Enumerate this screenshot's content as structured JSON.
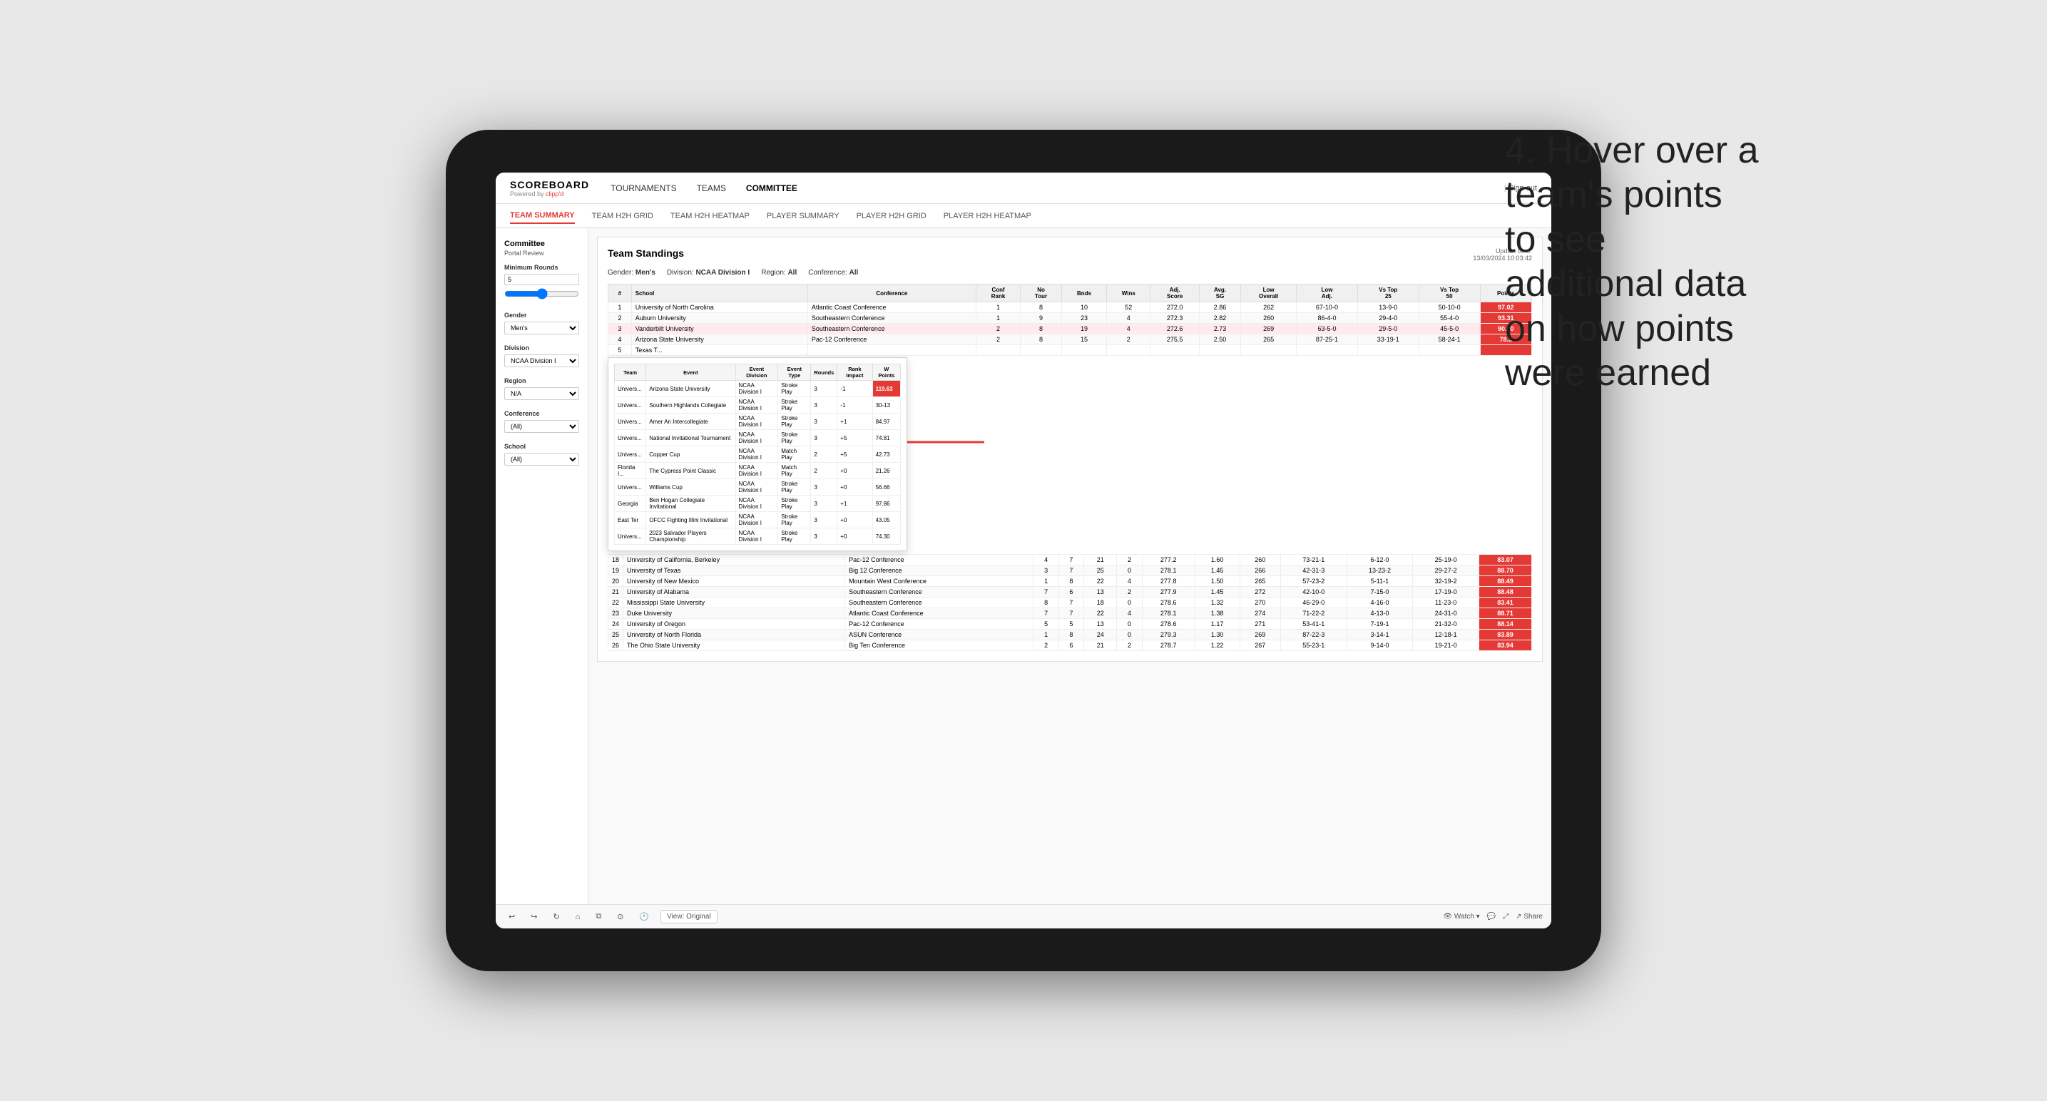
{
  "tablet": {
    "nav": {
      "logo_main": "SCOREBOARD",
      "logo_sub_prefix": "Powered by ",
      "logo_sub_brand": "clipp'd",
      "links": [
        {
          "label": "TOURNAMENTS",
          "active": false
        },
        {
          "label": "TEAMS",
          "active": false
        },
        {
          "label": "COMMITTEE",
          "active": true
        }
      ],
      "sign_out": "Sign out"
    },
    "sub_nav": [
      {
        "label": "TEAM SUMMARY",
        "active": true
      },
      {
        "label": "TEAM H2H GRID",
        "active": false
      },
      {
        "label": "TEAM H2H HEATMAP",
        "active": false
      },
      {
        "label": "PLAYER SUMMARY",
        "active": false
      },
      {
        "label": "PLAYER H2H GRID",
        "active": false
      },
      {
        "label": "PLAYER H2H HEATMAP",
        "active": false
      }
    ],
    "sidebar": {
      "heading": "Committee",
      "subheading": "Portal Review",
      "min_rounds_label": "Minimum Rounds",
      "gender_label": "Gender",
      "gender_value": "Men's",
      "division_label": "Division",
      "division_value": "NCAA Division I",
      "region_label": "Region",
      "region_value": "N/A",
      "conference_label": "Conference",
      "conference_value": "(All)",
      "school_label": "School",
      "school_value": "(All)"
    },
    "report": {
      "title": "Team Standings",
      "update_time": "Update time:",
      "update_date": "13/03/2024 10:03:42",
      "gender_label": "Gender:",
      "gender_value": "Men's",
      "division_label": "Division:",
      "division_value": "NCAA Division I",
      "region_label": "Region:",
      "region_value": "All",
      "conference_label": "Conference:",
      "conference_value": "All",
      "columns": [
        "#",
        "School",
        "Conference",
        "Conf Rank",
        "No Tour",
        "Bnds",
        "Wins",
        "Adj. Score",
        "Avg. SG",
        "Low Overall",
        "Low Adj.",
        "Vs Top 25",
        "Vs Top 50",
        "Points"
      ],
      "rows": [
        {
          "rank": 1,
          "school": "University of North Carolina",
          "conference": "Atlantic Coast Conference",
          "conf_rank": 1,
          "no_tour": 8,
          "bnds": 10,
          "wins": 52,
          "adj_score": "272.0",
          "avg_sg": "2.86",
          "low": "262",
          "low_adj": "67-10-0",
          "vs25": "13-9-0",
          "vs50": "50-10-0",
          "points": "97.02",
          "highlight": false
        },
        {
          "rank": 2,
          "school": "Auburn University",
          "conference": "Southeastern Conference",
          "conf_rank": 1,
          "no_tour": 9,
          "bnds": 23,
          "wins": 4,
          "adj_score": "272.3",
          "avg_sg": "2.82",
          "low": "260",
          "low_adj": "86-4-0",
          "vs25": "29-4-0",
          "vs50": "55-4-0",
          "points": "93.31",
          "highlight": false
        },
        {
          "rank": 3,
          "school": "Vanderbilt University",
          "conference": "Southeastern Conference",
          "conf_rank": 2,
          "no_tour": 8,
          "bnds": 19,
          "wins": 4,
          "adj_score": "272.6",
          "avg_sg": "2.73",
          "low": "269",
          "low_adj": "63-5-0",
          "vs25": "29-5-0",
          "vs50": "45-5-0",
          "points": "90.30",
          "highlight": true
        },
        {
          "rank": 4,
          "school": "Arizona State University",
          "conference": "Pac-12 Conference",
          "conf_rank": 2,
          "no_tour": 8,
          "bnds": 15,
          "wins": 2,
          "adj_score": "275.5",
          "avg_sg": "2.50",
          "low": "265",
          "low_adj": "87-25-1",
          "vs25": "33-19-1",
          "vs50": "58-24-1",
          "points": "78.5",
          "highlight": false
        },
        {
          "rank": 5,
          "school": "Texas T...",
          "conference": "",
          "conf_rank": "",
          "no_tour": "",
          "bnds": "",
          "wins": "",
          "adj_score": "",
          "avg_sg": "",
          "low": "",
          "low_adj": "",
          "vs25": "",
          "vs50": "",
          "points": "",
          "highlight": false
        }
      ],
      "tooltip_visible": true,
      "tooltip_school": "Vanderbilt University",
      "tooltip_columns": [
        "Team",
        "Event",
        "Event Division",
        "Event Type",
        "Rounds",
        "Rank Impact",
        "W Points"
      ],
      "tooltip_rows": [
        {
          "team": "Univers...",
          "event": "Arizona State University",
          "event_div": "NCAA Division I",
          "event_type": "Stroke Play",
          "rounds": 3,
          "rank_impact": -1,
          "w_points": "119.63"
        },
        {
          "team": "Univers...",
          "event": "Southern Highlands Collegiate",
          "event_div": "NCAA Division I",
          "event_type": "Stroke Play",
          "rounds": 3,
          "rank_impact": -1,
          "w_points": "30-13"
        },
        {
          "team": "Univers...",
          "event": "Amer An Intercollegiate",
          "event_div": "NCAA Division I",
          "event_type": "Stroke Play",
          "rounds": 3,
          "rank_impact": "+1",
          "w_points": "84.97"
        },
        {
          "team": "Univers...",
          "event": "National Invitational Tournament",
          "event_div": "NCAA Division I",
          "event_type": "Stroke Play",
          "rounds": 3,
          "rank_impact": "+5",
          "w_points": "74.81"
        },
        {
          "team": "Univers...",
          "event": "Copper Cup",
          "event_div": "NCAA Division I",
          "event_type": "Match Play",
          "rounds": 2,
          "rank_impact": "+5",
          "w_points": "42.73"
        },
        {
          "team": "Florida I...",
          "event": "The Cypress Point Classic",
          "event_div": "NCAA Division I",
          "event_type": "Match Play",
          "rounds": 2,
          "rank_impact": "+0",
          "w_points": "21.26"
        },
        {
          "team": "Univers...",
          "event": "Williams Cup",
          "event_div": "NCAA Division I",
          "event_type": "Stroke Play",
          "rounds": 3,
          "rank_impact": "+0",
          "w_points": "56.66"
        },
        {
          "team": "Georgia",
          "event": "Ben Hogan Collegiate Invitational",
          "event_div": "NCAA Division I",
          "event_type": "Stroke Play",
          "rounds": 3,
          "rank_impact": "+1",
          "w_points": "97.86"
        },
        {
          "team": "East Ter",
          "event": "OFCC Fighting Illini Invitational",
          "event_div": "NCAA Division I",
          "event_type": "Stroke Play",
          "rounds": 3,
          "rank_impact": "+0",
          "w_points": "43.05"
        },
        {
          "team": "Univers...",
          "event": "2023 Salvador Players Championship",
          "event_div": "NCAA Division I",
          "event_type": "Stroke Play",
          "rounds": 3,
          "rank_impact": "+0",
          "w_points": "74.30"
        }
      ],
      "more_rows": [
        {
          "rank": 18,
          "school": "University of California, Berkeley",
          "conference": "Pac-12 Conference",
          "conf_rank": 4,
          "no_tour": 7,
          "bnds": 21,
          "wins": 2,
          "adj_score": "277.2",
          "avg_sg": "1.60",
          "low": "260",
          "low_adj": "73-21-1",
          "vs25": "6-12-0",
          "vs50": "25-19-0",
          "points": "83.07"
        },
        {
          "rank": 19,
          "school": "University of Texas",
          "conference": "Big 12 Conference",
          "conf_rank": 3,
          "no_tour": 7,
          "bnds": 25,
          "wins": 0,
          "adj_score": "278.1",
          "avg_sg": "1.45",
          "low": "266",
          "low_adj": "42-31-3",
          "vs25": "13-23-2",
          "vs50": "29-27-2",
          "points": "88.70"
        },
        {
          "rank": 20,
          "school": "University of New Mexico",
          "conference": "Mountain West Conference",
          "conf_rank": 1,
          "no_tour": 8,
          "bnds": 22,
          "wins": 4,
          "adj_score": "277.8",
          "avg_sg": "1.50",
          "low": "265",
          "low_adj": "57-23-2",
          "vs25": "5-11-1",
          "vs50": "32-19-2",
          "points": "88.49"
        },
        {
          "rank": 21,
          "school": "University of Alabama",
          "conference": "Southeastern Conference",
          "conf_rank": 7,
          "no_tour": 6,
          "bnds": 13,
          "wins": 2,
          "adj_score": "277.9",
          "avg_sg": "1.45",
          "low": "272",
          "low_adj": "42-10-0",
          "vs25": "7-15-0",
          "vs50": "17-19-0",
          "points": "88.48"
        },
        {
          "rank": 22,
          "school": "Mississippi State University",
          "conference": "Southeastern Conference",
          "conf_rank": 8,
          "no_tour": 7,
          "bnds": 18,
          "wins": 0,
          "adj_score": "278.6",
          "avg_sg": "1.32",
          "low": "270",
          "low_adj": "46-29-0",
          "vs25": "4-16-0",
          "vs50": "11-23-0",
          "points": "83.41"
        },
        {
          "rank": 23,
          "school": "Duke University",
          "conference": "Atlantic Coast Conference",
          "conf_rank": 7,
          "no_tour": 7,
          "bnds": 22,
          "wins": 4,
          "adj_score": "278.1",
          "avg_sg": "1.38",
          "low": "274",
          "low_adj": "71-22-2",
          "vs25": "4-13-0",
          "vs50": "24-31-0",
          "points": "88.71"
        },
        {
          "rank": 24,
          "school": "University of Oregon",
          "conference": "Pac-12 Conference",
          "conf_rank": 5,
          "no_tour": 5,
          "bnds": 13,
          "wins": 0,
          "adj_score": "278.6",
          "avg_sg": "1.17",
          "low": "271",
          "low_adj": "53-41-1",
          "vs25": "7-19-1",
          "vs50": "21-32-0",
          "points": "88.14"
        },
        {
          "rank": 25,
          "school": "University of North Florida",
          "conference": "ASUN Conference",
          "conf_rank": 1,
          "no_tour": 8,
          "bnds": 24,
          "wins": 0,
          "adj_score": "279.3",
          "avg_sg": "1.30",
          "low": "269",
          "low_adj": "87-22-3",
          "vs25": "3-14-1",
          "vs50": "12-18-1",
          "points": "83.89"
        },
        {
          "rank": 26,
          "school": "The Ohio State University",
          "conference": "Big Ten Conference",
          "conf_rank": 2,
          "no_tour": 6,
          "bnds": 21,
          "wins": 2,
          "adj_score": "278.7",
          "avg_sg": "1.22",
          "low": "267",
          "low_adj": "55-23-1",
          "vs25": "9-14-0",
          "vs50": "19-21-0",
          "points": "83.94"
        }
      ]
    },
    "toolbar": {
      "view_label": "View: Original",
      "watch_label": "Watch",
      "share_label": "Share"
    }
  },
  "annotation": {
    "text": "4. Hover over a\nteam's points\nto see\nadditional data\non how points\nwere earned"
  }
}
